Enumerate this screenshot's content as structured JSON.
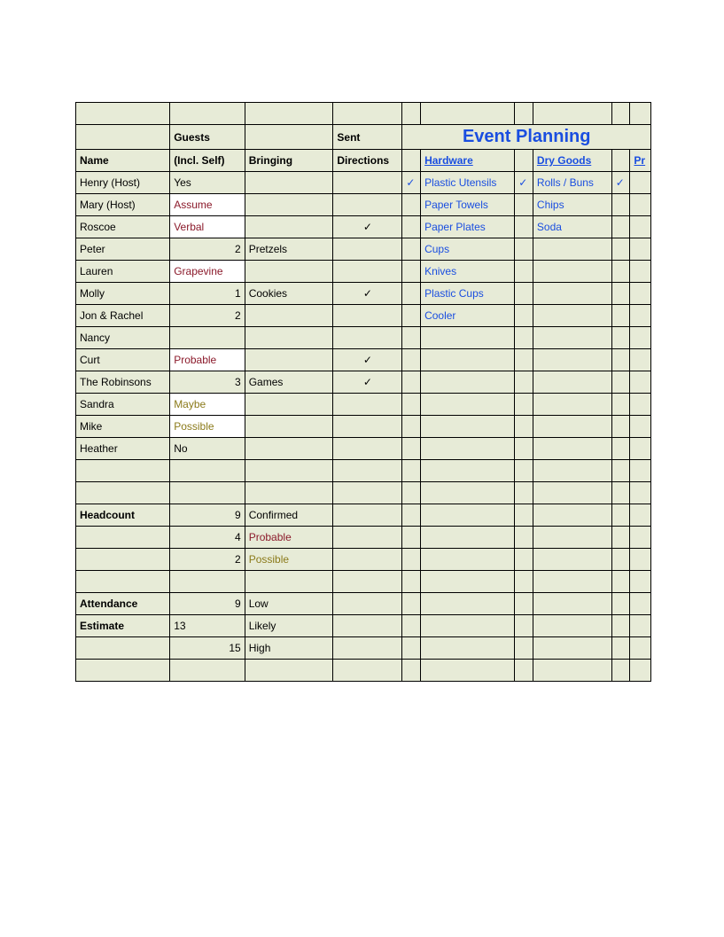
{
  "title": "Event Planning",
  "headers": {
    "guests": "Guests",
    "sent": "Sent",
    "name": "Name",
    "incl": "(Incl. Self)",
    "bringing": "Bringing",
    "directions": "Directions",
    "hardware": "Hardware",
    "drygoods": "Dry Goods",
    "pr": "Pr"
  },
  "rows": [
    {
      "name": "Henry (Host)",
      "guests": "Yes",
      "bringing": "",
      "dir": "",
      "hw": "Plastic Utensils",
      "hwchk": "✓",
      "dg": "Rolls / Buns",
      "dgchk": "✓",
      "prchk": "✓"
    },
    {
      "name": "Mary (Host)",
      "guests": "Assume",
      "guestsClass": "clr-assume whitebg",
      "bringing": "",
      "dir": "",
      "hw": "Paper Towels",
      "hwchk": "",
      "dg": "Chips",
      "dgchk": "",
      "prchk": ""
    },
    {
      "name": "Roscoe",
      "guests": "Verbal",
      "guestsClass": "clr-verbal whitebg",
      "bringing": "",
      "dir": "✓",
      "hw": "Paper Plates",
      "hwchk": "",
      "dg": "Soda",
      "dgchk": "",
      "prchk": ""
    },
    {
      "name": "Peter",
      "guests": "2",
      "guestsClass": "num",
      "bringing": "Pretzels",
      "dir": "",
      "hw": "Cups",
      "hwchk": "",
      "dg": "",
      "dgchk": "",
      "prchk": ""
    },
    {
      "name": "Lauren",
      "guests": "Grapevine",
      "guestsClass": "clr-assume whitebg",
      "bringing": "",
      "dir": "",
      "hw": "Knives",
      "hwchk": "",
      "dg": "",
      "dgchk": "",
      "prchk": ""
    },
    {
      "name": "Molly",
      "guests": "1",
      "guestsClass": "num",
      "bringing": "Cookies",
      "dir": "✓",
      "hw": "Plastic Cups",
      "hwchk": "",
      "dg": "",
      "dgchk": "",
      "prchk": ""
    },
    {
      "name": "Jon & Rachel",
      "guests": "2",
      "guestsClass": "num",
      "bringing": "",
      "dir": "",
      "hw": "Cooler",
      "hwchk": "",
      "dg": "",
      "dgchk": "",
      "prchk": ""
    },
    {
      "name": "Nancy",
      "guests": "",
      "bringing": "",
      "dir": "",
      "hw": "",
      "hwchk": "",
      "dg": "",
      "dgchk": "",
      "prchk": ""
    },
    {
      "name": "Curt",
      "guests": "Probable",
      "guestsClass": "clr-probable whitebg",
      "bringing": "",
      "dir": "✓",
      "hw": "",
      "hwchk": "",
      "dg": "",
      "dgchk": "",
      "prchk": ""
    },
    {
      "name": "The Robinsons",
      "guests": "3",
      "guestsClass": "num",
      "bringing": "Games",
      "dir": "✓",
      "hw": "",
      "hwchk": "",
      "dg": "",
      "dgchk": "",
      "prchk": ""
    },
    {
      "name": "Sandra",
      "guests": "Maybe",
      "guestsClass": "clr-maybe whitebg",
      "bringing": "",
      "dir": "",
      "hw": "",
      "hwchk": "",
      "dg": "",
      "dgchk": "",
      "prchk": ""
    },
    {
      "name": "Mike",
      "guests": "Possible",
      "guestsClass": "clr-possible whitebg",
      "bringing": "",
      "dir": "",
      "hw": "",
      "hwchk": "",
      "dg": "",
      "dgchk": "",
      "prchk": ""
    },
    {
      "name": "Heather",
      "guests": "No",
      "bringing": "",
      "dir": "",
      "hw": "",
      "hwchk": "",
      "dg": "",
      "dgchk": "",
      "prchk": ""
    }
  ],
  "blank1": {
    "name": "",
    "guests": "",
    "bringing": "",
    "dir": ""
  },
  "blank2": {
    "name": "",
    "guests": "",
    "bringing": "",
    "dir": ""
  },
  "summary": [
    {
      "name": "Headcount",
      "nameBold": true,
      "guests": "9",
      "guestsClass": "num",
      "bringing": "Confirmed"
    },
    {
      "name": "",
      "guests": "4",
      "guestsClass": "num",
      "bringing": "Probable",
      "bringClass": "clr-probable"
    },
    {
      "name": "",
      "guests": "2",
      "guestsClass": "num",
      "bringing": "Possible",
      "bringClass": "clr-possible"
    },
    {
      "name": "",
      "guests": "",
      "bringing": ""
    },
    {
      "name": "Attendance",
      "nameBold": true,
      "guests": "9",
      "guestsClass": "num",
      "bringing": "Low"
    },
    {
      "name": "Estimate",
      "nameBold": true,
      "guests": "13",
      "bringing": "Likely"
    },
    {
      "name": "",
      "guests": "15",
      "guestsClass": "num",
      "bringing": "High"
    },
    {
      "name": "",
      "guests": "",
      "bringing": ""
    }
  ]
}
